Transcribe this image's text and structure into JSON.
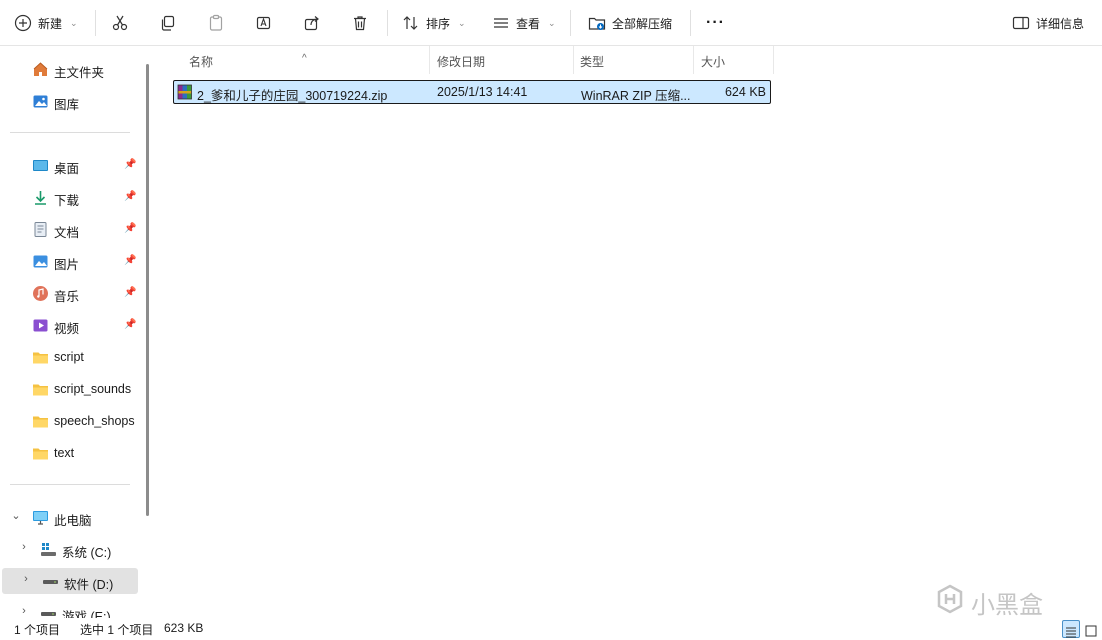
{
  "toolbar": {
    "new_label": "新建",
    "sort_label": "排序",
    "view_label": "查看",
    "extract_label": "全部解压缩",
    "more_label": "···",
    "details_label": "详细信息"
  },
  "sidebar": {
    "quick": [
      {
        "label": "主文件夹",
        "icon": "home-icon"
      },
      {
        "label": "图库",
        "icon": "gallery-icon"
      }
    ],
    "pinned": [
      {
        "label": "桌面",
        "icon": "desktop-icon"
      },
      {
        "label": "下载",
        "icon": "download-icon"
      },
      {
        "label": "文档",
        "icon": "documents-icon"
      },
      {
        "label": "图片",
        "icon": "pictures-icon"
      },
      {
        "label": "音乐",
        "icon": "music-icon"
      },
      {
        "label": "视频",
        "icon": "videos-icon"
      }
    ],
    "folders": [
      {
        "label": "script"
      },
      {
        "label": "script_sounds"
      },
      {
        "label": "speech_shops"
      },
      {
        "label": "text"
      }
    ],
    "this_pc": "此电脑",
    "drives": [
      {
        "label": "系统 (C:)"
      },
      {
        "label": "软件 (D:)"
      },
      {
        "label": "游戏 (E:)"
      }
    ]
  },
  "filelist": {
    "columns": [
      "名称",
      "修改日期",
      "类型",
      "大小"
    ],
    "rows": [
      {
        "name": "2_爹和儿子的庄园_300719224.zip",
        "modified": "2025/1/13 14:41",
        "type": "WinRAR ZIP 压缩...",
        "size": "624 KB"
      }
    ]
  },
  "status": {
    "item_count": "1 个项目",
    "selected": "选中 1 个项目",
    "selected_size": "623 KB"
  },
  "watermark": "小黑盒",
  "colors": {
    "selection": "#cce8ff",
    "folder": "#f5c242",
    "accent": "#0067c0"
  }
}
